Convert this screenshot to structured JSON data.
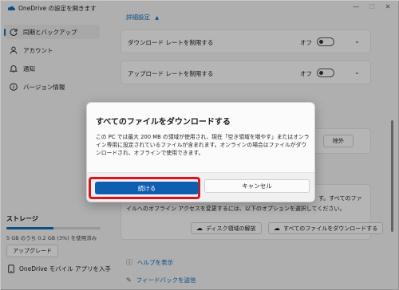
{
  "window": {
    "title": "OneDrive の設定を開きます",
    "minimize_glyph": "—",
    "maximize_glyph": "☐",
    "close_glyph": "✕"
  },
  "sidebar": {
    "items": [
      {
        "label": "同期とバックアップ",
        "icon": "sync-icon",
        "active": true
      },
      {
        "label": "アカウント",
        "icon": "person-icon",
        "active": false
      },
      {
        "label": "通知",
        "icon": "bell-icon",
        "active": false
      },
      {
        "label": "バージョン情報",
        "icon": "info-icon",
        "active": false
      }
    ],
    "storage_title": "ストレージ",
    "storage_used_fraction": 0.5,
    "storage_text": "5 GB のうち 0.2 GB (3%) を使用済み",
    "upgrade_label": "アップグレード",
    "mobile_app_label": "OneDrive モバイル アプリを入手"
  },
  "main": {
    "advanced_label": "詳細設定",
    "settings": [
      {
        "label": "ダウンロード レートを制限する",
        "toggle_text": "オフ",
        "on": false
      },
      {
        "label": "アップロード レートを制限する",
        "toggle_text": "オフ",
        "on": false
      }
    ],
    "exclude_label": "除外",
    "files_text_1": "す。すべてのファ",
    "files_text_2": "イルへのオフライン アクセスを変更するには、以下のオプションを選択してください。",
    "free_space_label": "ディスク領域の解放",
    "download_all_label": "すべてのファイルをダウンロードする",
    "help_label": "ヘルプを表示",
    "feedback_label": "フィードバックを送信"
  },
  "dialog": {
    "title": "すべてのファイルをダウンロードする",
    "body": "この PC では最大 200 MB の領域が使用され、現在「空き領域を増やす」またはオンライン専用に設定されているファイルが含まれます。オンラインの場合はファイルがダウンロードされ、オフラインで使用できます。",
    "continue_label": "続ける",
    "cancel_label": "キャンセル"
  },
  "colors": {
    "accent": "#0f6cbd",
    "primary_button": "#0f5fb0",
    "highlight": "#e0121d"
  }
}
